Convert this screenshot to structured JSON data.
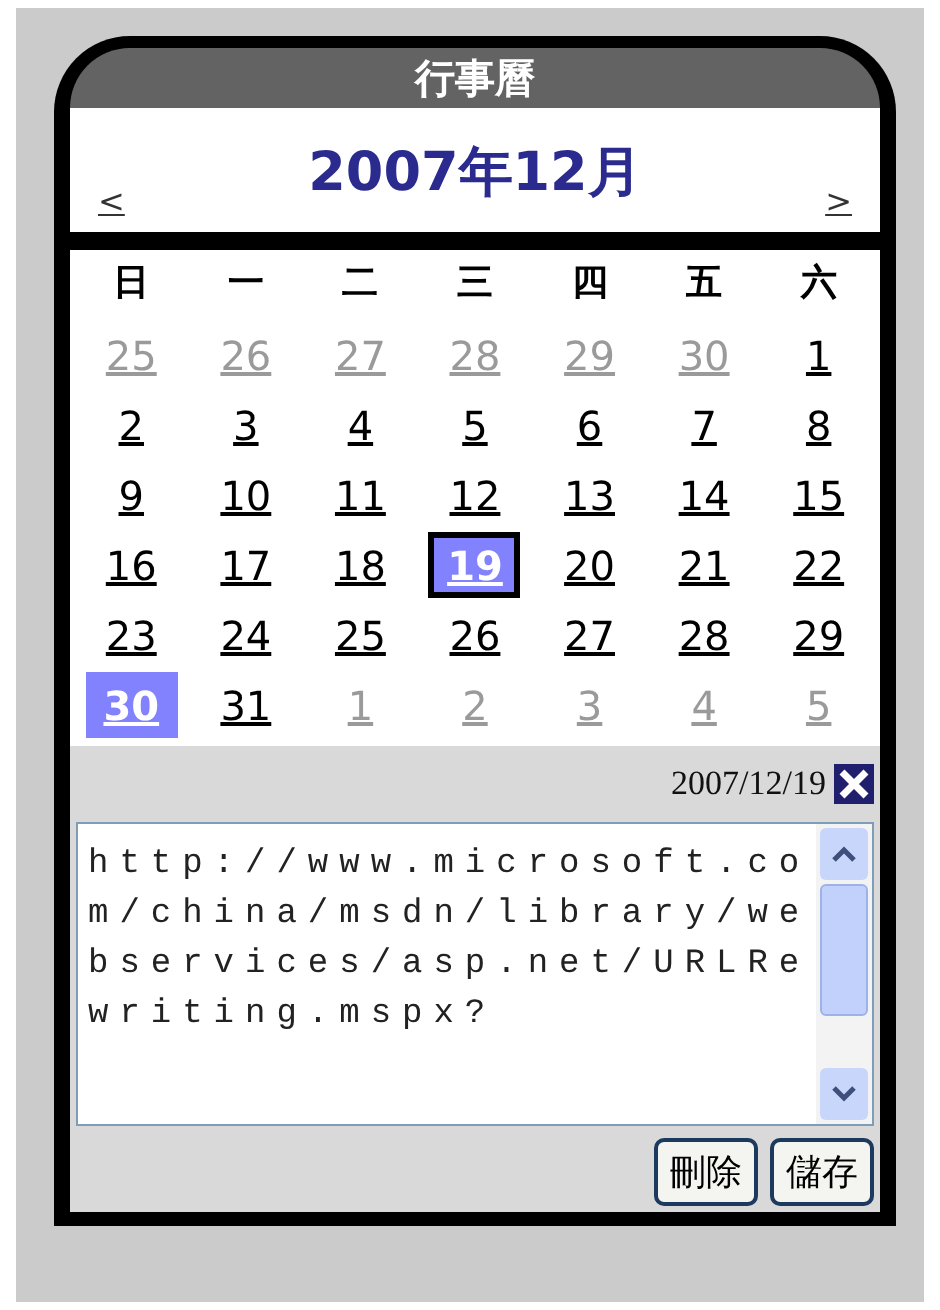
{
  "window": {
    "title": "行事曆"
  },
  "month": {
    "title": "2007年12月",
    "prev": "<",
    "next": ">"
  },
  "weekdays": [
    "日",
    "一",
    "二",
    "三",
    "四",
    "五",
    "六"
  ],
  "weeks": [
    [
      {
        "label": "25",
        "other_month": true,
        "selected": false,
        "highlighted": false
      },
      {
        "label": "26",
        "other_month": true,
        "selected": false,
        "highlighted": false
      },
      {
        "label": "27",
        "other_month": true,
        "selected": false,
        "highlighted": false
      },
      {
        "label": "28",
        "other_month": true,
        "selected": false,
        "highlighted": false
      },
      {
        "label": "29",
        "other_month": true,
        "selected": false,
        "highlighted": false
      },
      {
        "label": "30",
        "other_month": true,
        "selected": false,
        "highlighted": false
      },
      {
        "label": "1",
        "other_month": false,
        "selected": false,
        "highlighted": false
      }
    ],
    [
      {
        "label": "2",
        "other_month": false,
        "selected": false,
        "highlighted": false
      },
      {
        "label": "3",
        "other_month": false,
        "selected": false,
        "highlighted": false
      },
      {
        "label": "4",
        "other_month": false,
        "selected": false,
        "highlighted": false
      },
      {
        "label": "5",
        "other_month": false,
        "selected": false,
        "highlighted": false
      },
      {
        "label": "6",
        "other_month": false,
        "selected": false,
        "highlighted": false
      },
      {
        "label": "7",
        "other_month": false,
        "selected": false,
        "highlighted": false
      },
      {
        "label": "8",
        "other_month": false,
        "selected": false,
        "highlighted": false
      }
    ],
    [
      {
        "label": "9",
        "other_month": false,
        "selected": false,
        "highlighted": false
      },
      {
        "label": "10",
        "other_month": false,
        "selected": false,
        "highlighted": false
      },
      {
        "label": "11",
        "other_month": false,
        "selected": false,
        "highlighted": false
      },
      {
        "label": "12",
        "other_month": false,
        "selected": false,
        "highlighted": false
      },
      {
        "label": "13",
        "other_month": false,
        "selected": false,
        "highlighted": false
      },
      {
        "label": "14",
        "other_month": false,
        "selected": false,
        "highlighted": false
      },
      {
        "label": "15",
        "other_month": false,
        "selected": false,
        "highlighted": false
      }
    ],
    [
      {
        "label": "16",
        "other_month": false,
        "selected": false,
        "highlighted": false
      },
      {
        "label": "17",
        "other_month": false,
        "selected": false,
        "highlighted": false
      },
      {
        "label": "18",
        "other_month": false,
        "selected": false,
        "highlighted": false
      },
      {
        "label": "19",
        "other_month": false,
        "selected": true,
        "highlighted": false
      },
      {
        "label": "20",
        "other_month": false,
        "selected": false,
        "highlighted": false
      },
      {
        "label": "21",
        "other_month": false,
        "selected": false,
        "highlighted": false
      },
      {
        "label": "22",
        "other_month": false,
        "selected": false,
        "highlighted": false
      }
    ],
    [
      {
        "label": "23",
        "other_month": false,
        "selected": false,
        "highlighted": false
      },
      {
        "label": "24",
        "other_month": false,
        "selected": false,
        "highlighted": false
      },
      {
        "label": "25",
        "other_month": false,
        "selected": false,
        "highlighted": false
      },
      {
        "label": "26",
        "other_month": false,
        "selected": false,
        "highlighted": false
      },
      {
        "label": "27",
        "other_month": false,
        "selected": false,
        "highlighted": false
      },
      {
        "label": "28",
        "other_month": false,
        "selected": false,
        "highlighted": false
      },
      {
        "label": "29",
        "other_month": false,
        "selected": false,
        "highlighted": false
      }
    ],
    [
      {
        "label": "30",
        "other_month": false,
        "selected": false,
        "highlighted": true
      },
      {
        "label": "31",
        "other_month": false,
        "selected": false,
        "highlighted": false
      },
      {
        "label": "1",
        "other_month": true,
        "selected": false,
        "highlighted": false
      },
      {
        "label": "2",
        "other_month": true,
        "selected": false,
        "highlighted": false
      },
      {
        "label": "3",
        "other_month": true,
        "selected": false,
        "highlighted": false
      },
      {
        "label": "4",
        "other_month": true,
        "selected": false,
        "highlighted": false
      },
      {
        "label": "5",
        "other_month": true,
        "selected": false,
        "highlighted": false
      }
    ]
  ],
  "editor": {
    "date": "2007/12/19",
    "value": "http://www.microsoft.com/china/msdn/library/webservices/asp.net/URLRewriting.mspx?"
  },
  "buttons": [
    "刪除",
    "儲存"
  ]
}
